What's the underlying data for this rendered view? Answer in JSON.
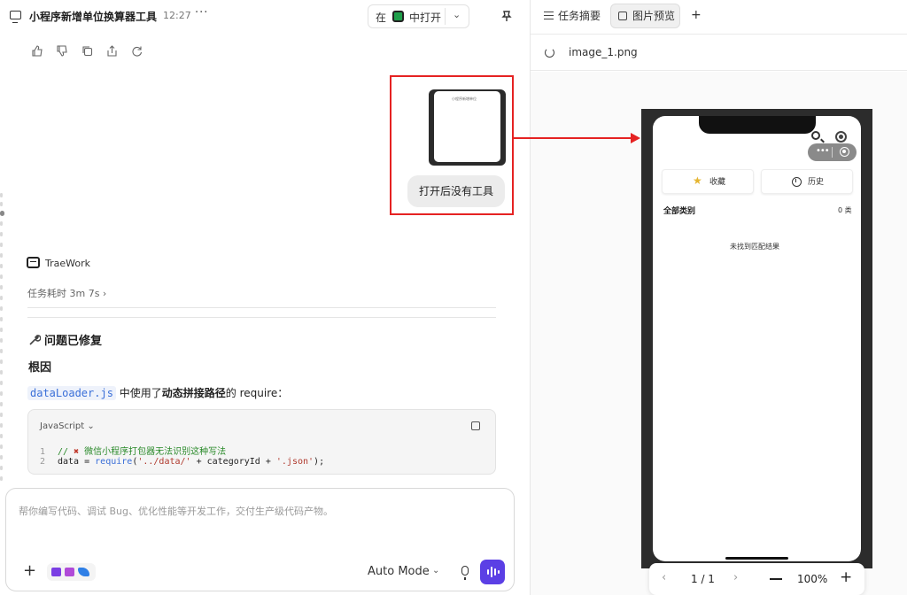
{
  "header": {
    "title": "小程序新增单位换算器工具",
    "time": "12:27",
    "more": "···",
    "open_in_prefix": "在",
    "open_in_suffix": "中打开"
  },
  "message": {
    "thumbnail_caption": "小程序新增单位",
    "user_text": "打开后没有工具"
  },
  "agent": {
    "name": "TraeWork",
    "task_duration": "任务耗时 3m 7s ›"
  },
  "answer": {
    "heading": "问题已修复",
    "subheading": "根因",
    "desc_code": "dataLoader.js",
    "desc_text1": " 中使用了",
    "desc_bold": "动态拼接路径",
    "desc_text2": "的 require："
  },
  "code_block": {
    "language": "JavaScript",
    "lines": [
      {
        "no": "1",
        "comment_prefix": "// ",
        "mark": "✖",
        "comment": " 微信小程序打包器无法识别这种写法"
      },
      {
        "no": "2",
        "p1": "data = ",
        "fn": "require",
        "p2": "(",
        "s1": "'../data/'",
        "p3": " + categoryId + ",
        "s2": "'.json'",
        "p4": ");"
      }
    ]
  },
  "composer": {
    "placeholder": "帮你编写代码、调试 Bug、优化性能等开发工作，交付生产级代码产物。",
    "mode": "Auto Mode"
  },
  "preview": {
    "tabs": [
      "任务摘要",
      "图片预览"
    ],
    "filename": "image_1.png",
    "phone": {
      "favorites": "收藏",
      "history": "历史",
      "all_categories": "全部类别",
      "count": "0 类",
      "empty": "未找到匹配结果"
    },
    "pager": {
      "prev": "‹",
      "page": "1 / 1",
      "next": "›",
      "zoom": "100%"
    }
  },
  "colors": {
    "accent": "#5b3fe5",
    "annotation_red": "#e52222",
    "code_link": "#3a6fd8"
  }
}
